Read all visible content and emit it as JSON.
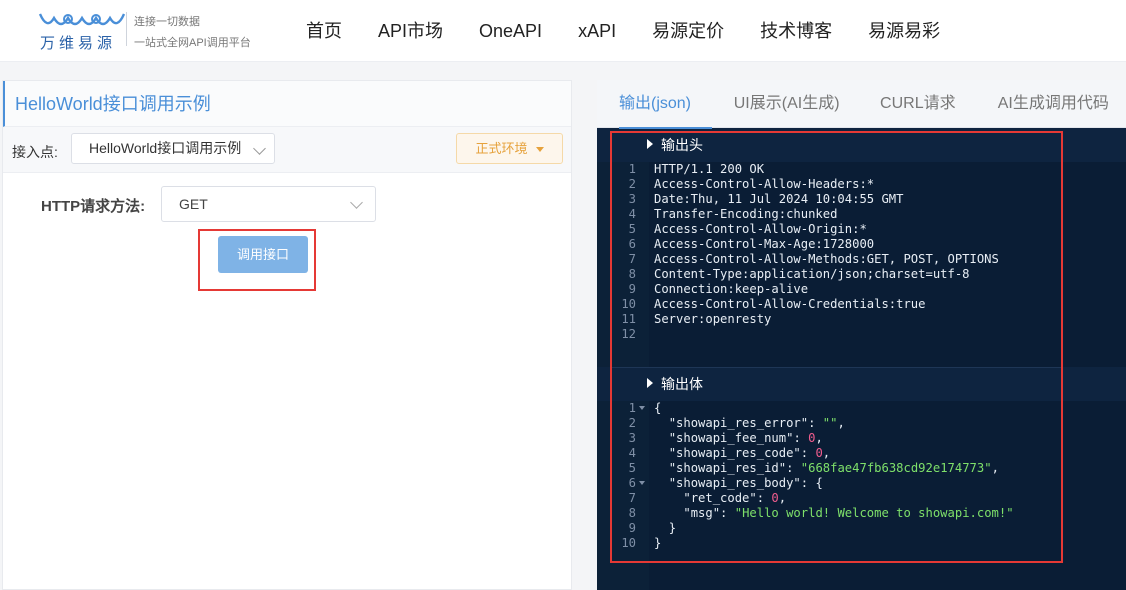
{
  "header": {
    "logo_name": "万维易源",
    "slogan_line1": "连接一切数据",
    "slogan_line2": "一站式全网API调用平台",
    "nav": [
      "首页",
      "API市场",
      "OneAPI",
      "xAPI",
      "易源定价",
      "技术博客",
      "易源易彩"
    ]
  },
  "left_panel": {
    "title": "HelloWorld接口调用示例",
    "endpoint_label": "接入点:",
    "endpoint_value": "HelloWorld接口调用示例",
    "env_label": "正式环境",
    "method_label": "HTTP请求方法:",
    "method_value": "GET",
    "call_button": "调用接口"
  },
  "right_panel": {
    "tabs": [
      "输出(json)",
      "UI展示(AI生成)",
      "CURL请求",
      "AI生成调用代码"
    ],
    "header_section_title": "输出头",
    "body_section_title": "输出体",
    "header_lines": [
      "HTTP/1.1 200 OK",
      "Access-Control-Allow-Headers:*",
      "Date:Thu, 11 Jul 2024 10:04:55 GMT",
      "Transfer-Encoding:chunked",
      "Access-Control-Allow-Origin:*",
      "Access-Control-Max-Age:1728000",
      "Access-Control-Allow-Methods:GET, POST, OPTIONS",
      "Content-Type:application/json;charset=utf-8",
      "Connection:keep-alive",
      "Access-Control-Allow-Credentials:true",
      "Server:openresty",
      ""
    ],
    "body_lines": [
      {
        "indent": "",
        "parts": [
          [
            "punc",
            "{"
          ]
        ],
        "fold": true
      },
      {
        "indent": "  ",
        "parts": [
          [
            "key",
            "\"showapi_res_error\""
          ],
          [
            "punc",
            ": "
          ],
          [
            "str",
            "\"\""
          ],
          [
            "punc",
            ","
          ]
        ]
      },
      {
        "indent": "  ",
        "parts": [
          [
            "key",
            "\"showapi_fee_num\""
          ],
          [
            "punc",
            ": "
          ],
          [
            "num",
            "0"
          ],
          [
            "punc",
            ","
          ]
        ]
      },
      {
        "indent": "  ",
        "parts": [
          [
            "key",
            "\"showapi_res_code\""
          ],
          [
            "punc",
            ": "
          ],
          [
            "num",
            "0"
          ],
          [
            "punc",
            ","
          ]
        ]
      },
      {
        "indent": "  ",
        "parts": [
          [
            "key",
            "\"showapi_res_id\""
          ],
          [
            "punc",
            ": "
          ],
          [
            "str",
            "\"668fae47fb638cd92e174773\""
          ],
          [
            "punc",
            ","
          ]
        ]
      },
      {
        "indent": "  ",
        "parts": [
          [
            "key",
            "\"showapi_res_body\""
          ],
          [
            "punc",
            ": {"
          ]
        ],
        "fold": true
      },
      {
        "indent": "    ",
        "parts": [
          [
            "key",
            "\"ret_code\""
          ],
          [
            "punc",
            ": "
          ],
          [
            "num",
            "0"
          ],
          [
            "punc",
            ","
          ]
        ]
      },
      {
        "indent": "    ",
        "parts": [
          [
            "key",
            "\"msg\""
          ],
          [
            "punc",
            ": "
          ],
          [
            "str",
            "\"Hello world! Welcome to showapi.com!\""
          ]
        ]
      },
      {
        "indent": "  ",
        "parts": [
          [
            "punc",
            "}"
          ]
        ]
      },
      {
        "indent": "",
        "parts": [
          [
            "punc",
            "}"
          ]
        ]
      }
    ]
  }
}
